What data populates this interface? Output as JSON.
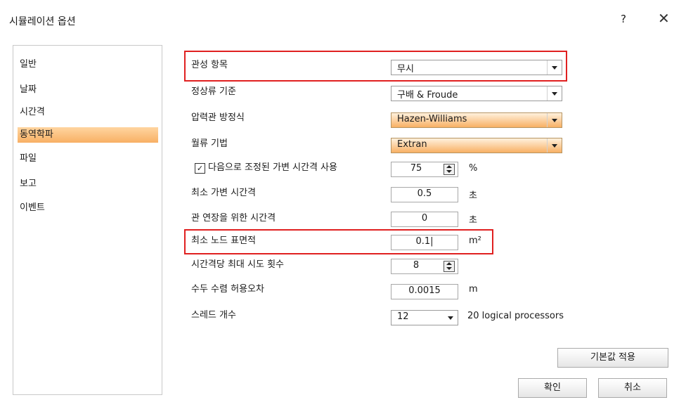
{
  "dialog": {
    "title": "시뮬레이션 옵션",
    "help": "?",
    "close": "✕"
  },
  "sidebar": {
    "items": [
      {
        "label": "일반"
      },
      {
        "label": "날짜"
      },
      {
        "label": "시간격"
      },
      {
        "label": "동역학파"
      },
      {
        "label": "파일"
      },
      {
        "label": "보고"
      },
      {
        "label": "이벤트"
      }
    ],
    "selected": "동역학파"
  },
  "rows": {
    "inertia": {
      "label": "관성 항목",
      "value": "무시"
    },
    "normal_flow": {
      "label": "정상류 기준",
      "value": "구배 & Froude"
    },
    "force_main": {
      "label": "압력관 방정식",
      "value": "Hazen-Williams"
    },
    "surcharge": {
      "label": "월류 기법",
      "value": "Extran"
    },
    "variable_step": {
      "label": "다음으로 조정된 가변 시간격 사용",
      "checked": "✓",
      "value": "75",
      "unit": "%"
    },
    "min_step": {
      "label": "최소 가변 시간격",
      "value": "0.5",
      "unit": "초"
    },
    "lengthening": {
      "label": "관 연장을 위한 시간격",
      "value": "0",
      "unit": "초"
    },
    "min_surface": {
      "label": "최소 노드 표면적",
      "value": "0.1|",
      "unit": "m²"
    },
    "max_trials": {
      "label": "시간격당 최대 시도 횟수",
      "value": "8"
    },
    "head_tol": {
      "label": "수두 수렴 허용오차",
      "value": "0.0015",
      "unit": "m"
    },
    "threads": {
      "label": "스레드 개수",
      "value": "12",
      "note": "20 logical processors"
    }
  },
  "buttons": {
    "defaults": "기본값 적용",
    "ok": "확인",
    "cancel": "취소"
  },
  "colors": {
    "highlight": "#e02020",
    "selection": "#f8b064"
  }
}
